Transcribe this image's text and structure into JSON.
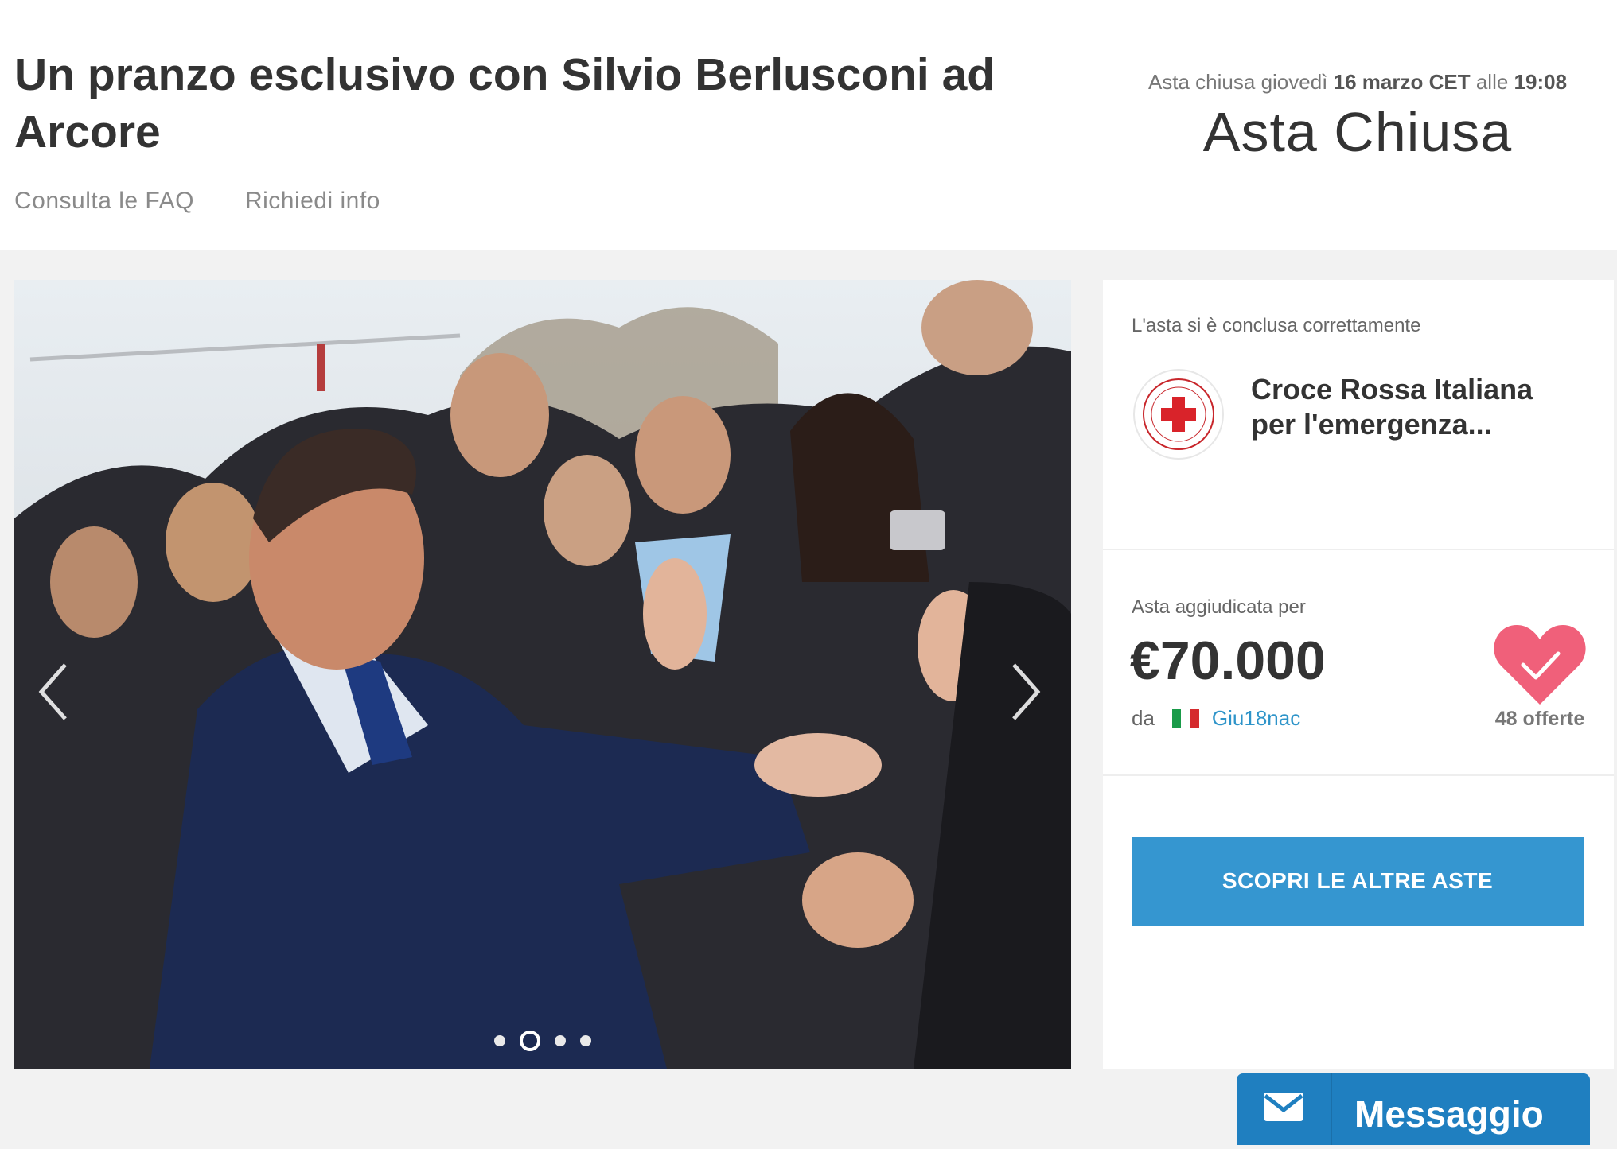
{
  "header": {
    "title": "Un pranzo esclusivo con Silvio Berlusconi ad Arcore",
    "links": [
      "Consulta le FAQ",
      "Richiedi info"
    ],
    "closed_info": {
      "prefix": "Asta chiusa giovedì",
      "date": "16 marzo CET",
      "middle": "alle",
      "time": "19:08"
    },
    "status": "Asta Chiusa"
  },
  "gallery": {
    "dot_count": 4,
    "active_dot_index": 1
  },
  "sidebar": {
    "concluded_text": "L'asta si è conclusa correttamente",
    "organization": "Croce Rossa Italiana per l'emergenza...",
    "awarded_label": "Asta aggiudicata per",
    "price": "€70.000",
    "by_label": "da",
    "bidder": "Giu18nac",
    "offers": "48 offerte",
    "cta": "SCOPRI LE ALTRE ASTE"
  },
  "message_button": {
    "label": "Messaggio"
  },
  "colors": {
    "accent_blue": "#3596d0",
    "heart_pink": "#f0607a",
    "link_blue": "#2e94c9"
  }
}
